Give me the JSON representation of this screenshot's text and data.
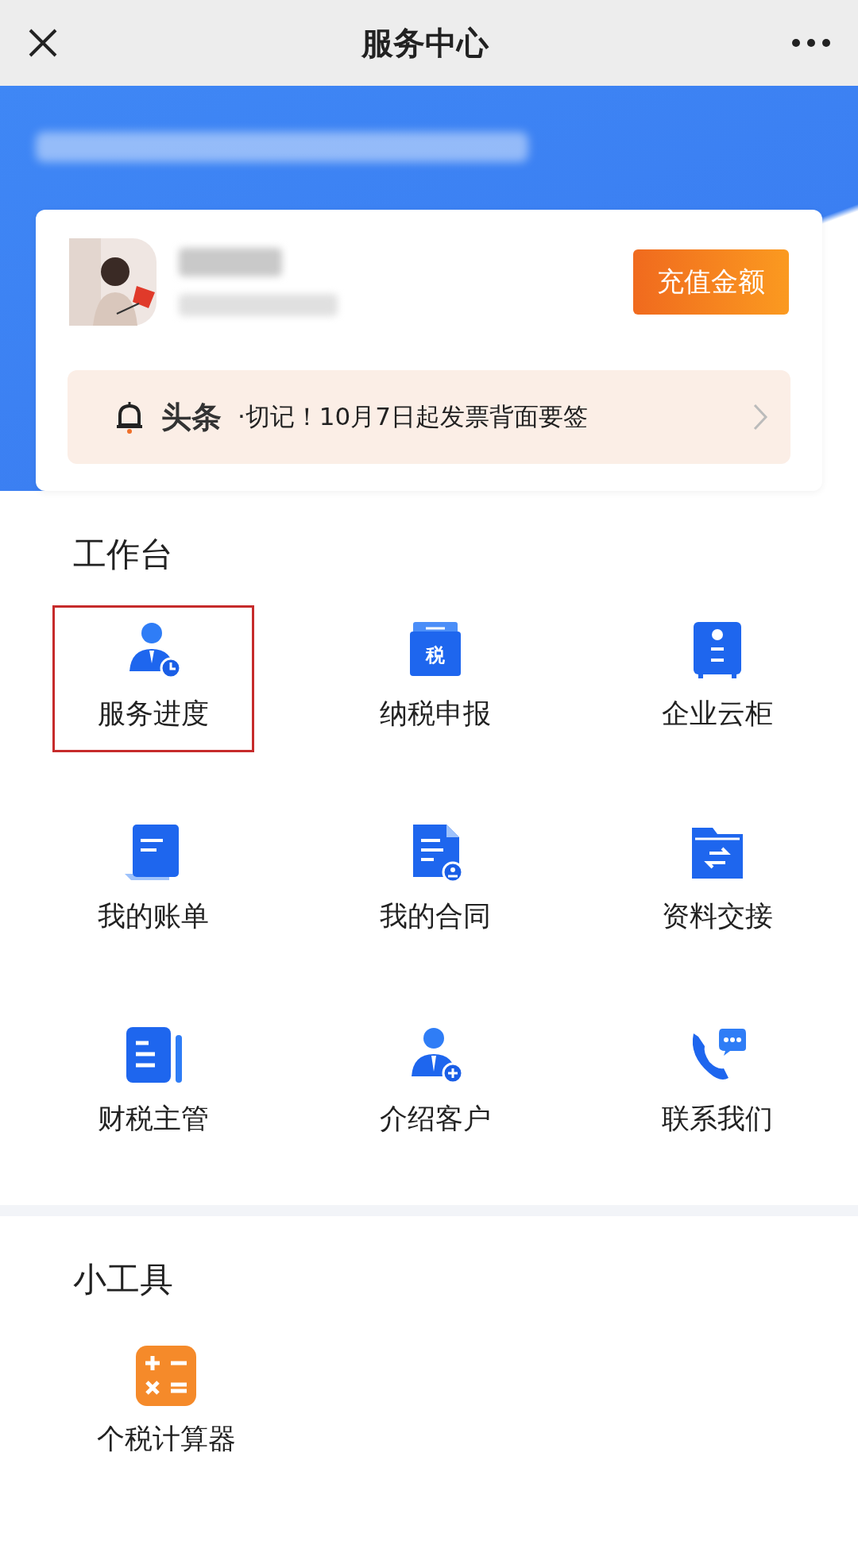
{
  "top_bar": {
    "title": "服务中心"
  },
  "account": {
    "recharge_button": "充值金额"
  },
  "notice": {
    "source": "头条",
    "text": "·切记！10月7日起发票背面要签"
  },
  "workbench": {
    "title": "工作台",
    "tax_icon_text": "税",
    "items": [
      {
        "label": "服务进度",
        "kind": "progress",
        "selected": true
      },
      {
        "label": "纳税申报",
        "kind": "tax",
        "selected": false
      },
      {
        "label": "企业云柜",
        "kind": "cabinet",
        "selected": false
      },
      {
        "label": "我的账单",
        "kind": "bill",
        "selected": false
      },
      {
        "label": "我的合同",
        "kind": "contract",
        "selected": false
      },
      {
        "label": "资料交接",
        "kind": "handover",
        "selected": false
      },
      {
        "label": "财税主管",
        "kind": "manager",
        "selected": false
      },
      {
        "label": "介绍客户",
        "kind": "referral",
        "selected": false
      },
      {
        "label": "联系我们",
        "kind": "contact",
        "selected": false
      }
    ]
  },
  "tools": {
    "title": "小工具",
    "items": [
      {
        "label": "个税计算器",
        "kind": "calculator"
      }
    ]
  }
}
